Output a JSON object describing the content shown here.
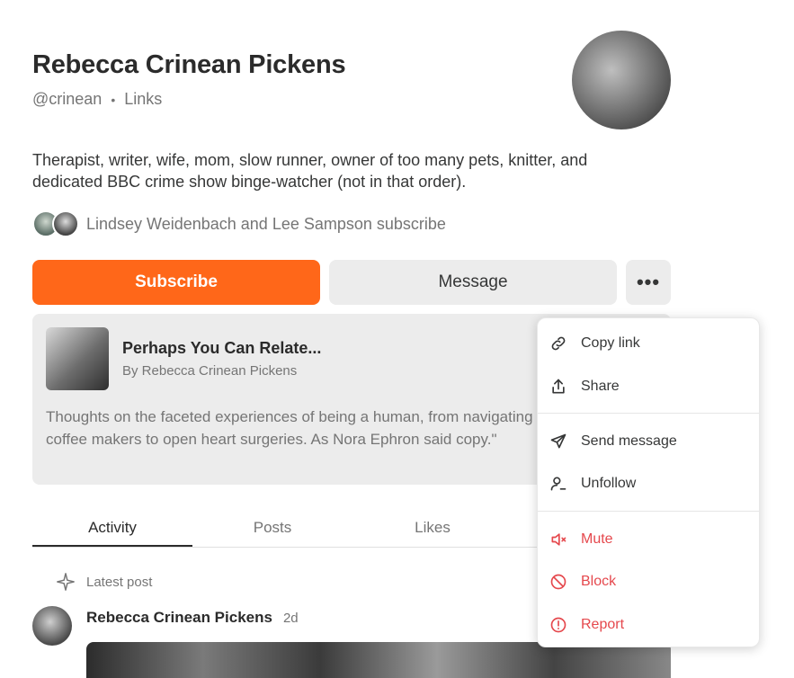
{
  "profile": {
    "name": "Rebecca Crinean Pickens",
    "handle": "@crinean",
    "separator": "•",
    "links_label": "Links",
    "bio": "Therapist, writer, wife, mom, slow runner, owner of too many pets, knitter, and dedicated BBC crime show binge-watcher (not in that order).",
    "subscribers_text": "Lindsey Weidenbach and Lee Sampson subscribe"
  },
  "actions": {
    "subscribe_label": "Subscribe",
    "message_label": "Message",
    "more_label": "•••"
  },
  "publication": {
    "title": "Perhaps You Can Relate...",
    "byline": "By Rebecca Crinean Pickens",
    "description": "Thoughts on the faceted experiences of being a human, from navigating complicated coffee makers to open heart surgeries. As Nora Ephron said copy.\""
  },
  "tabs": [
    "Activity",
    "Posts",
    "Likes"
  ],
  "feed": {
    "section_label": "Latest post",
    "post_author": "Rebecca Crinean Pickens",
    "post_age": "2d"
  },
  "menu": {
    "items": [
      {
        "label": "Copy link",
        "icon": "link-icon"
      },
      {
        "label": "Share",
        "icon": "share-icon"
      },
      {
        "label": "Send message",
        "icon": "send-icon"
      },
      {
        "label": "Unfollow",
        "icon": "unfollow-icon"
      },
      {
        "label": "Mute",
        "icon": "mute-icon"
      },
      {
        "label": "Block",
        "icon": "block-icon"
      },
      {
        "label": "Report",
        "icon": "report-icon"
      }
    ]
  },
  "colors": {
    "accent": "#ff6719",
    "danger": "#e5484d",
    "button_gray": "#ececec"
  }
}
